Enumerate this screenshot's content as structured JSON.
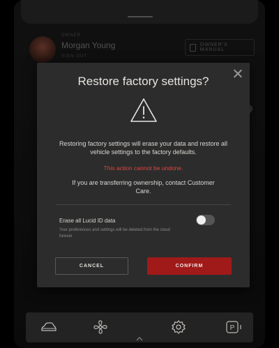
{
  "profile": {
    "kicker": "OWNER",
    "name": "Morgan Young",
    "subtitle": "SIGN OUT",
    "manual_label": "OWNER'S MANUAL"
  },
  "dialog": {
    "title": "Restore factory settings?",
    "body": "Restoring factory settings will erase your data and restore all vehicle settings to the factory defaults.",
    "warning": "This action cannot be undone.",
    "transfer": "If you are transferring ownership, contact Customer Care.",
    "erase": {
      "label": "Erase all Lucid ID data",
      "help": "Your preferences and settings will be deleted from the cloud forever",
      "enabled": false
    },
    "cancel_label": "CANCEL",
    "confirm_label": "CONFIRM"
  },
  "colors": {
    "accent_confirm": "#a01a1a",
    "warning_text": "#e0443f",
    "dialog_bg": "#2c2c2c"
  },
  "nav": {
    "items": [
      {
        "icon": "car-icon"
      },
      {
        "icon": "fan-icon"
      },
      {
        "icon": "gear-icon"
      },
      {
        "icon": "parking-icon",
        "label": "P"
      }
    ]
  }
}
